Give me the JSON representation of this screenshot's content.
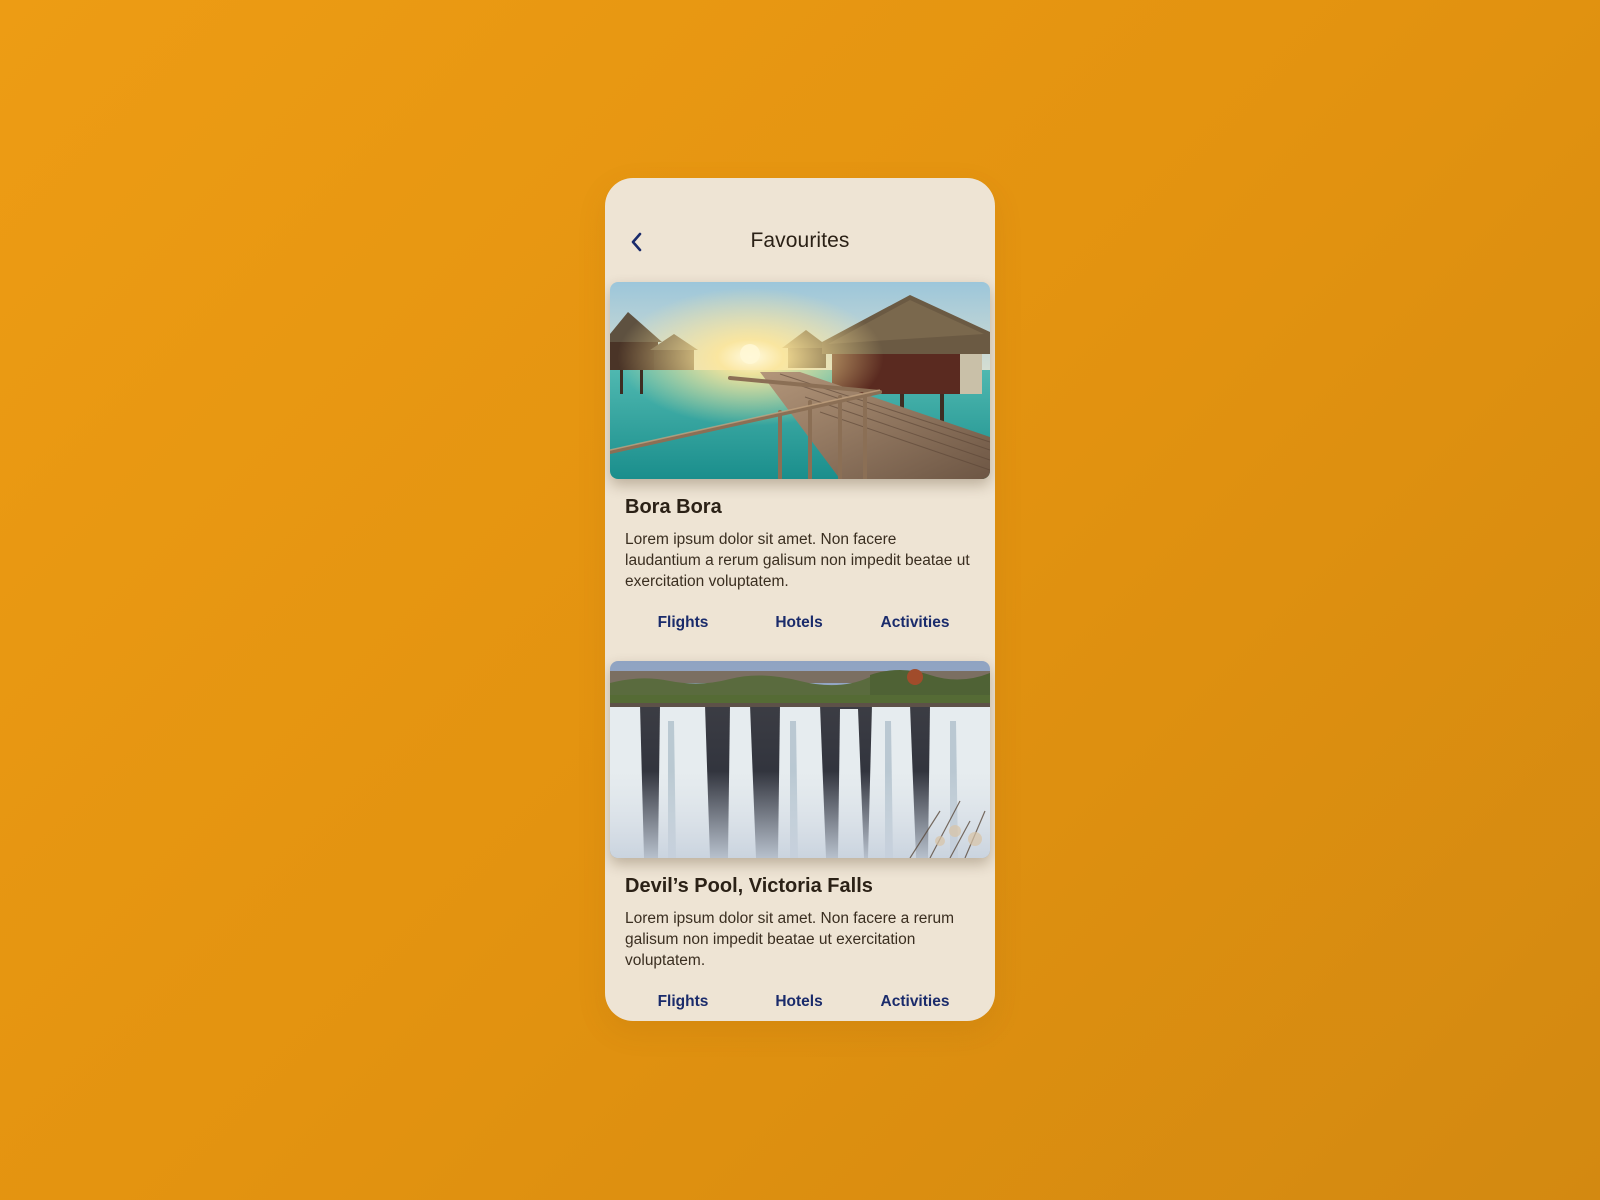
{
  "header": {
    "title": "Favourites",
    "back_icon": "chevron-left-icon"
  },
  "colors": {
    "background": "#E8990F",
    "phone_background": "#EEE4D4",
    "link": "#1A2B6B",
    "title_text": "#2B2116"
  },
  "favourites": [
    {
      "title": "Bora Bora",
      "description": "Lorem ipsum dolor sit amet. Non facere laudantium a rerum galisum non impedit beatae ut exercitation voluptatem.",
      "links": [
        "Flights",
        "Hotels",
        "Activities"
      ]
    },
    {
      "title": "Devil’s Pool, Victoria Falls",
      "description": "Lorem ipsum dolor sit amet. Non facere a rerum galisum non impedit beatae ut exercitation voluptatem.",
      "links": [
        "Flights",
        "Hotels",
        "Activities"
      ]
    }
  ]
}
